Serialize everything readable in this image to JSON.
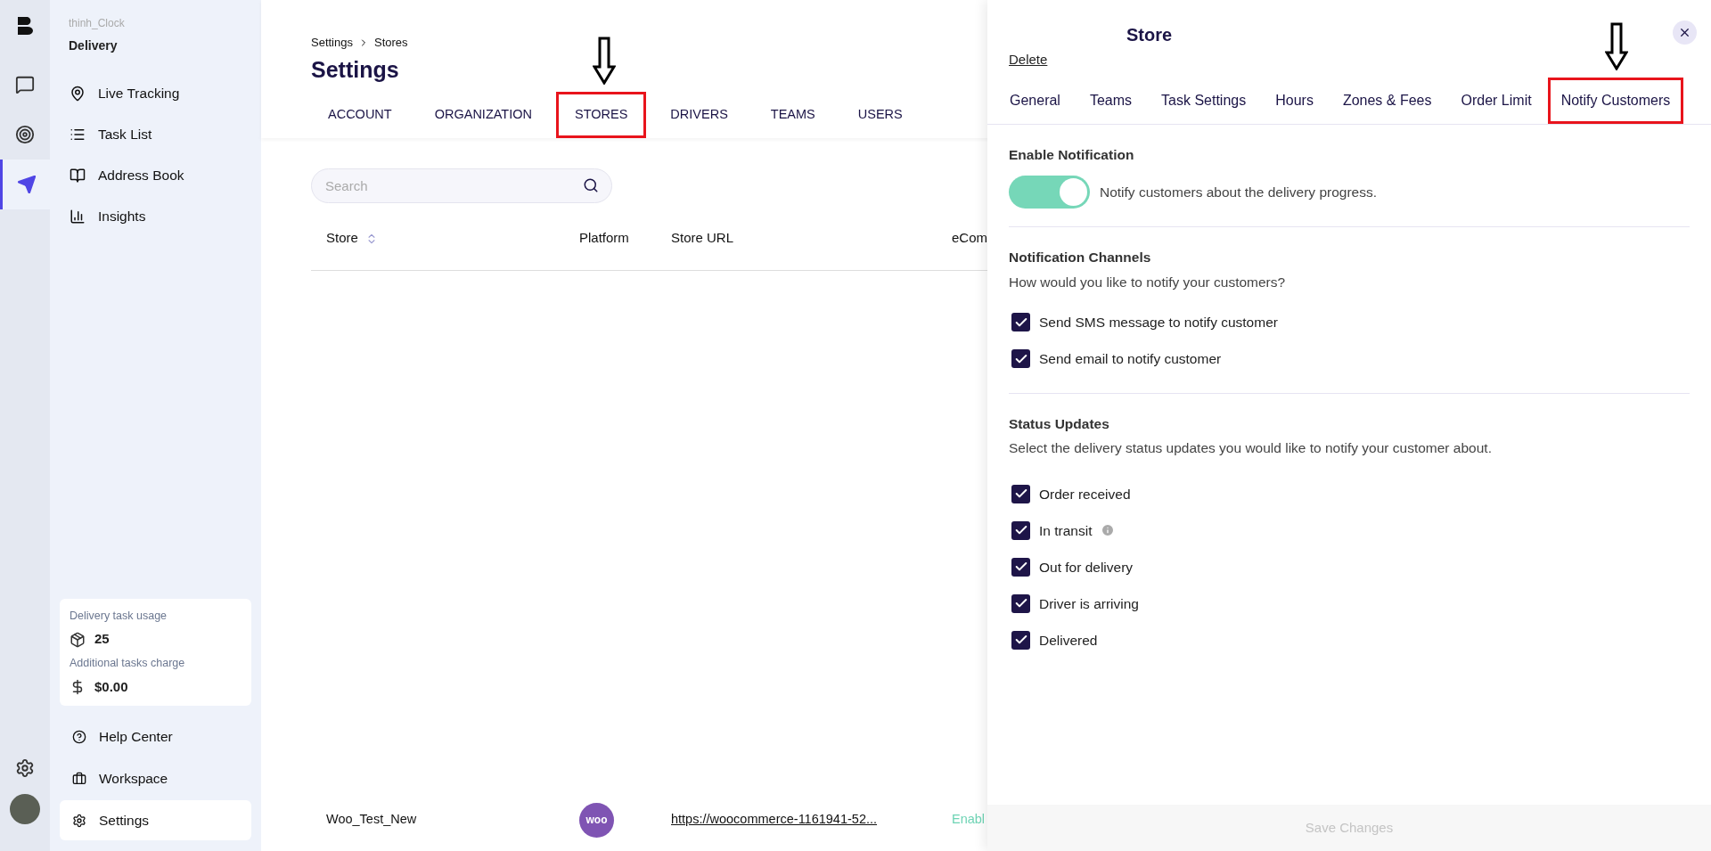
{
  "icon_rail": [
    {
      "kind": "chat",
      "selected": false
    },
    {
      "kind": "target",
      "selected": false
    },
    {
      "kind": "send",
      "selected": true
    }
  ],
  "sidebar": {
    "account": "thinh_Clock",
    "product": "Delivery",
    "nav": [
      {
        "label": "Live Tracking",
        "kind": "pin"
      },
      {
        "label": "Task List",
        "kind": "list"
      },
      {
        "label": "Address Book",
        "kind": "book"
      },
      {
        "label": "Insights",
        "kind": "chart"
      }
    ],
    "usage": {
      "label": "Delivery task usage",
      "count": "25",
      "charge_label": "Additional tasks charge",
      "charge": "$0.00"
    },
    "footer_nav": [
      {
        "label": "Help Center",
        "kind": "help",
        "selected": false
      },
      {
        "label": "Workspace",
        "kind": "briefcase",
        "selected": false
      },
      {
        "label": "Settings",
        "kind": "gear",
        "selected": true
      }
    ]
  },
  "page": {
    "breadcrumb": [
      "Settings",
      "Stores"
    ],
    "title": "Settings",
    "tabs": [
      {
        "label": "ACCOUNT",
        "highlighted": false
      },
      {
        "label": "ORGANIZATION",
        "highlighted": false
      },
      {
        "label": "STORES",
        "highlighted": true
      },
      {
        "label": "DRIVERS",
        "highlighted": false
      },
      {
        "label": "TEAMS",
        "highlighted": false
      },
      {
        "label": "USERS",
        "highlighted": false
      }
    ],
    "search": {
      "placeholder": "Search"
    },
    "table": {
      "store_column_sortable": true,
      "columns": [
        {
          "label": "Store"
        },
        {
          "label": "Platform"
        },
        {
          "label": "Store URL"
        },
        {
          "label": "eCom"
        }
      ],
      "rows": [
        {
          "store": "Woo_Test_New",
          "platform": "woo",
          "url": "https://woocommerce-1161941-52...",
          "column_4": "Enabl"
        }
      ]
    }
  },
  "panel": {
    "title": "Store",
    "delete": "Delete",
    "tabs": [
      {
        "label": "General",
        "highlighted": false
      },
      {
        "label": "Teams",
        "highlighted": false
      },
      {
        "label": "Task Settings",
        "highlighted": false
      },
      {
        "label": "Hours",
        "highlighted": false
      },
      {
        "label": "Zones & Fees",
        "highlighted": false
      },
      {
        "label": "Order Limit",
        "highlighted": false
      },
      {
        "label": "Notify Customers",
        "highlighted": true
      }
    ],
    "enable": {
      "heading": "Enable Notification",
      "on": true,
      "label": "Notify customers about the delivery progress."
    },
    "channels": {
      "heading": "Notification Channels",
      "description": "How would you like to notify your customers?",
      "options": [
        {
          "label": "Send SMS message to notify customer",
          "checked": true,
          "info": false
        },
        {
          "label": "Send email to notify customer",
          "checked": true,
          "info": false
        }
      ]
    },
    "status": {
      "heading": "Status Updates",
      "description": "Select the delivery status updates you would like to notify your customer about.",
      "options": [
        {
          "label": "Order received",
          "checked": true,
          "info": false
        },
        {
          "label": "In transit",
          "checked": true,
          "info": true
        },
        {
          "label": "Out for delivery",
          "checked": true,
          "info": false
        },
        {
          "label": "Driver is arriving",
          "checked": true,
          "info": false
        },
        {
          "label": "Delivered",
          "checked": true,
          "info": false
        }
      ]
    },
    "save": {
      "label": "Save Changes",
      "disabled": true
    }
  }
}
